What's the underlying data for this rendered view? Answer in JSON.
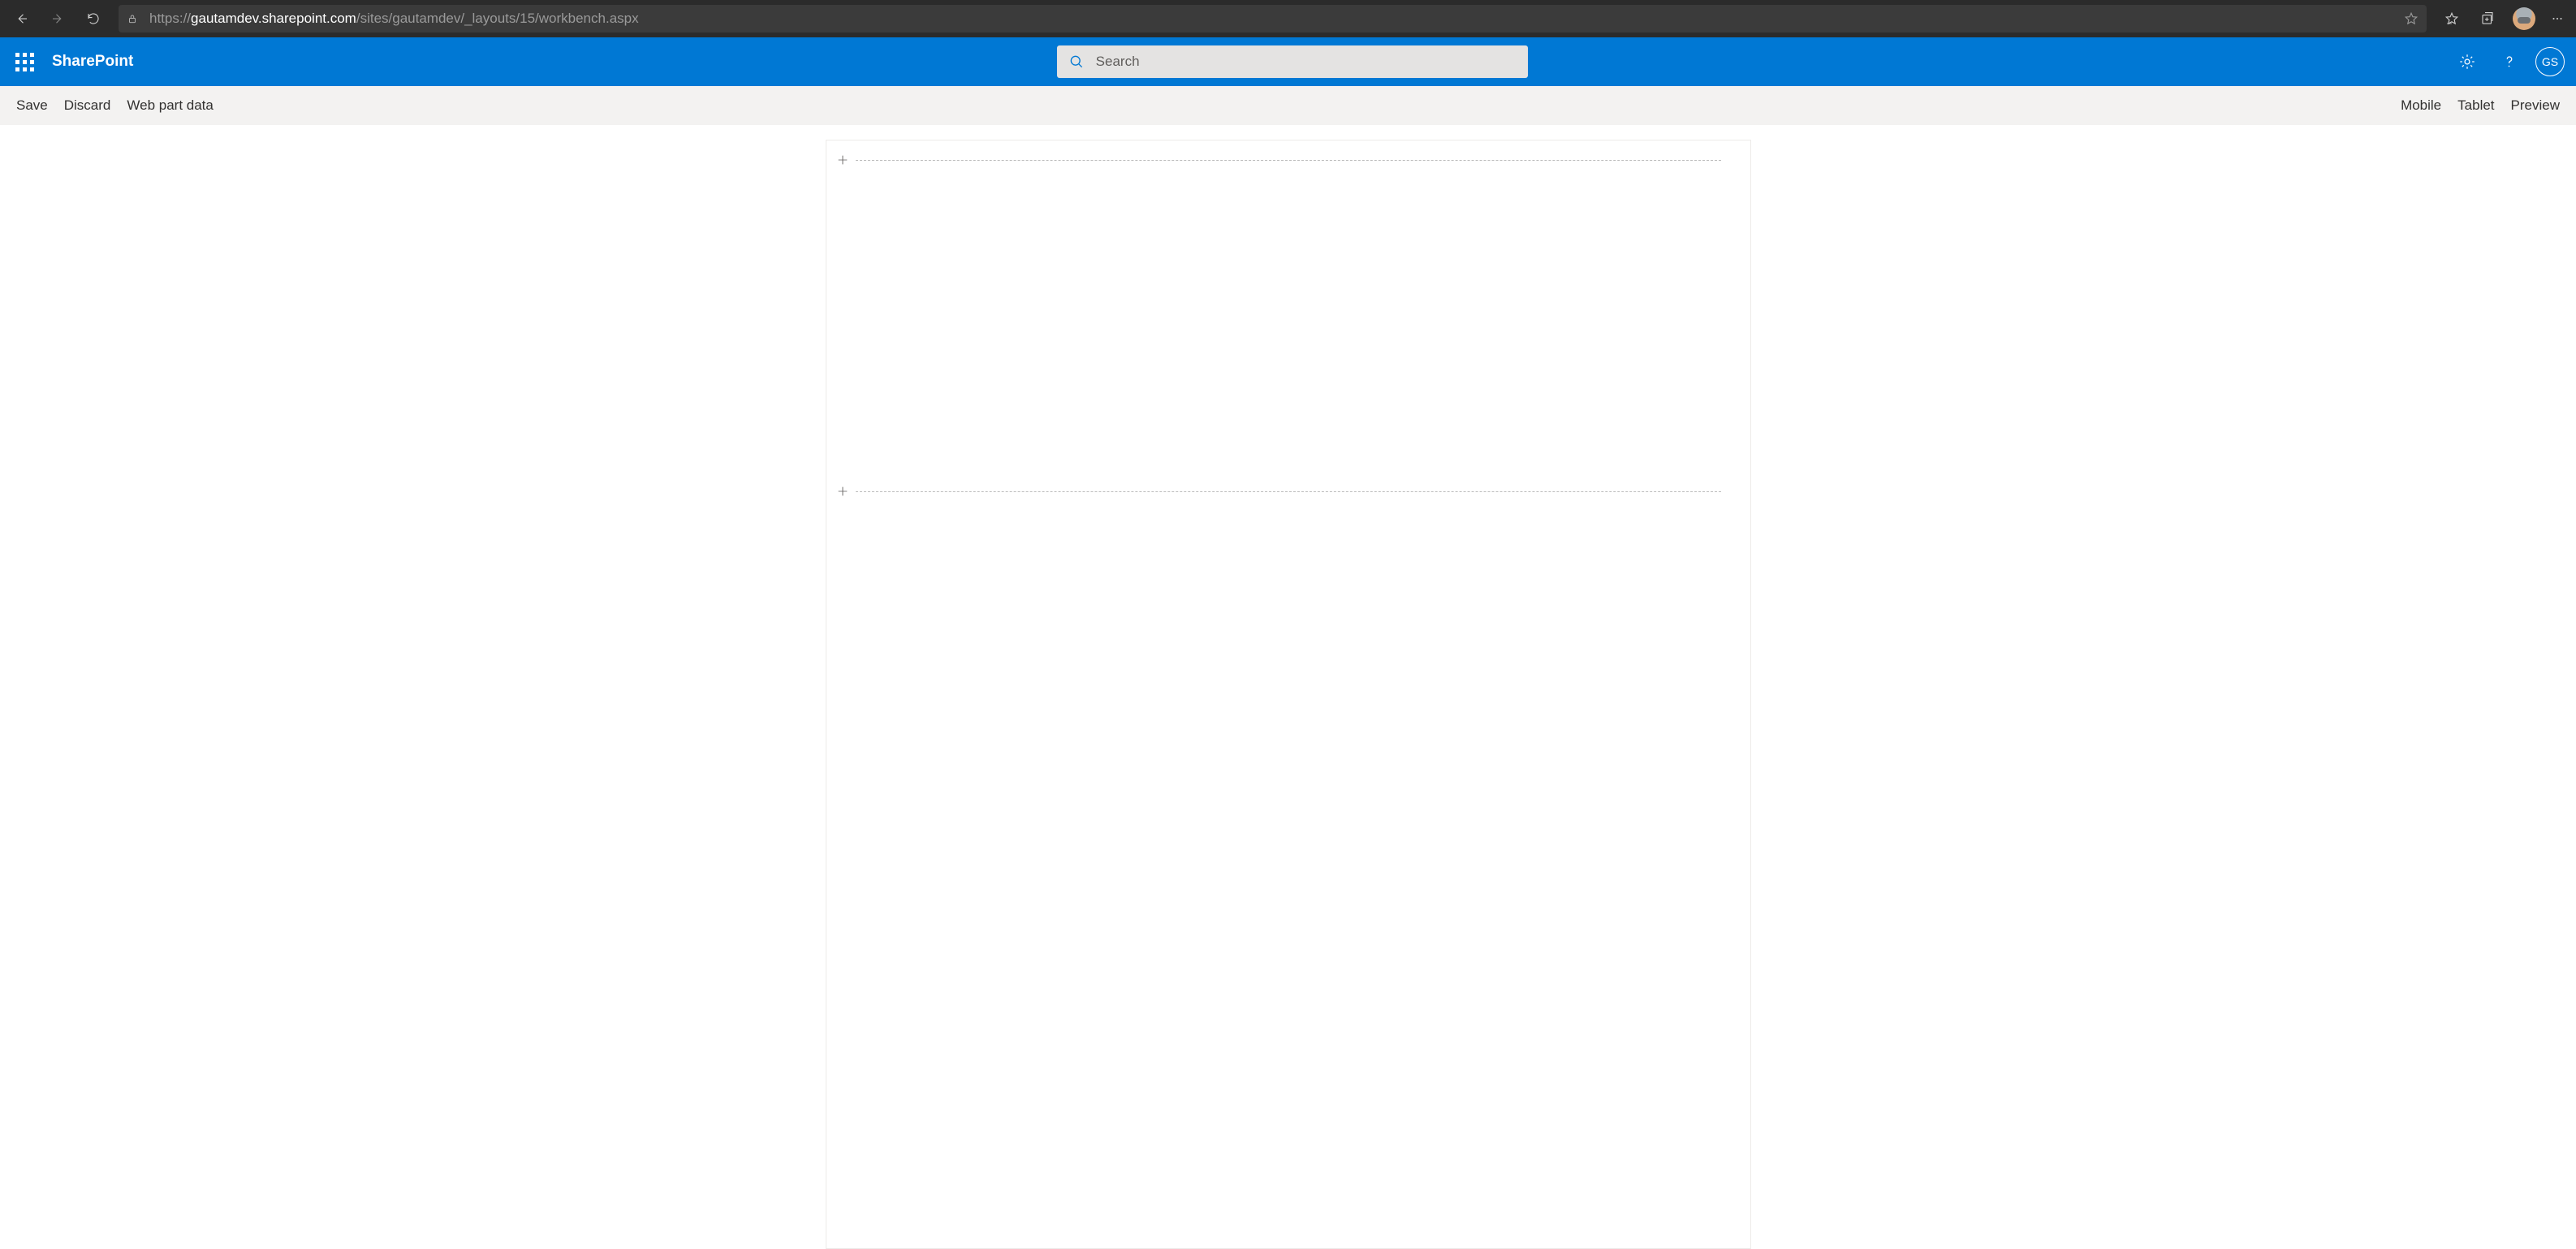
{
  "browser": {
    "url_protocol": "https://",
    "url_host": "gautamdev.sharepoint.com",
    "url_path": "/sites/gautamdev/_layouts/15/workbench.aspx"
  },
  "suite": {
    "brand": "SharePoint",
    "search_placeholder": "Search",
    "persona_initials": "GS"
  },
  "commandbar": {
    "left": {
      "save": "Save",
      "discard": "Discard",
      "webpartdata": "Web part data"
    },
    "right": {
      "mobile": "Mobile",
      "tablet": "Tablet",
      "preview": "Preview"
    }
  }
}
